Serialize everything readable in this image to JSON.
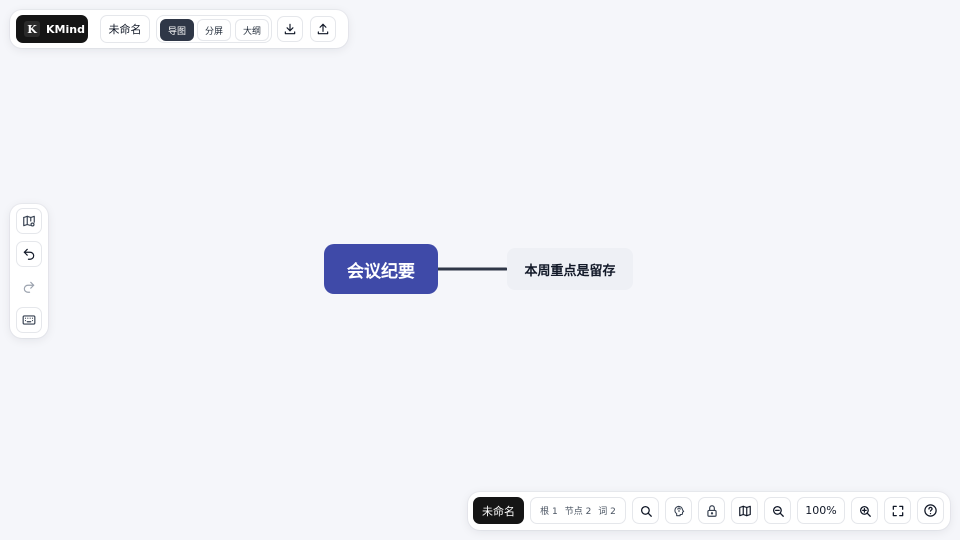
{
  "top_toolbar": {
    "brand_logo_letter": "K",
    "brand_name": "KMind",
    "document_name": "未命名",
    "view_modes": [
      {
        "label": "导图",
        "active": true
      },
      {
        "label": "分屏",
        "active": false
      },
      {
        "label": "大纲",
        "active": false
      }
    ],
    "download_icon": "download-icon",
    "upload_icon": "upload-icon"
  },
  "left_panel": {
    "icons": [
      "map-settings-icon",
      "undo-icon",
      "redo-icon",
      "keyboard-icon"
    ]
  },
  "mindmap": {
    "root": {
      "label": "会议纪要",
      "color": "#3f4aa8"
    },
    "children": [
      {
        "label": "本周重点是留存"
      }
    ],
    "connector_color": "#2f3747"
  },
  "bottom_toolbar": {
    "document_name": "未命名",
    "stats": {
      "roots": "根 1",
      "nodes": "节点 2",
      "words": "词 2"
    },
    "zoom_level": "100%",
    "icons": [
      "search-icon",
      "brain-icon",
      "lock-icon",
      "map-icon",
      "zoom-out-icon",
      "zoom-in-icon",
      "fullscreen-icon",
      "help-icon"
    ]
  },
  "colors": {
    "background": "#f5f6fa",
    "dark_button": "#151515",
    "active_view": "#2f3747",
    "child_node_bg": "#eef0f5"
  }
}
